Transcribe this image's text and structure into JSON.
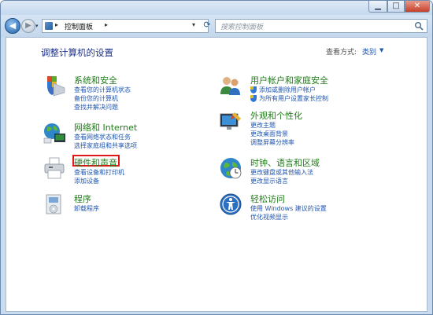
{
  "window": {
    "minimize_glyph": "▁",
    "maximize_glyph": "□",
    "close_glyph": "✕"
  },
  "navbar": {
    "back_glyph": "◀",
    "forward_glyph": "▶",
    "history_glyph": "▾",
    "breadcrumb": "控制面板",
    "separator": "▸",
    "address_dropdown_glyph": "▾",
    "refresh_glyph": "⟳",
    "search_placeholder": "搜索控制面板"
  },
  "main": {
    "heading": "调整计算机的设置",
    "view_by_label": "查看方式:",
    "view_mode": "类别",
    "view_mode_arrow": "▼"
  },
  "categories": {
    "system_security": {
      "icon": "shield-flag-icon",
      "title": "系统和安全",
      "links": [
        "查看您的计算机状态",
        "备份您的计算机",
        "查找并解决问题"
      ]
    },
    "network": {
      "icon": "globe-network-icon",
      "title": "网络和 Internet",
      "links": [
        "查看网络状态和任务",
        "选择家庭组和共享选项"
      ]
    },
    "hardware": {
      "icon": "printer-icon",
      "title": "硬件和声音",
      "links": [
        "查看设备和打印机",
        "添加设备"
      ]
    },
    "programs": {
      "icon": "program-box-icon",
      "title": "程序",
      "links": [
        "卸载程序"
      ]
    },
    "user_accounts": {
      "icon": "users-icon",
      "title": "用户帐户和家庭安全",
      "links": [
        "添加或删除用户帐户",
        "为所有用户设置家长控制"
      ]
    },
    "appearance": {
      "icon": "monitor-paint-icon",
      "title": "外观和个性化",
      "links": [
        "更改主题",
        "更改桌面背景",
        "调整屏幕分辨率"
      ]
    },
    "clock_region": {
      "icon": "clock-globe-icon",
      "title": "时钟、语言和区域",
      "links": [
        "更改键盘或其他输入法",
        "更改显示语言"
      ]
    },
    "ease_of_access": {
      "icon": "ease-of-access-icon",
      "title": "轻松访问",
      "links": [
        "使用 Windows 建议的设置",
        "优化视频显示"
      ]
    }
  },
  "colors": {
    "category_title": "#1e7c17",
    "link": "#1f56b0",
    "heading": "#1e3287",
    "highlight_box": "#e11616"
  }
}
